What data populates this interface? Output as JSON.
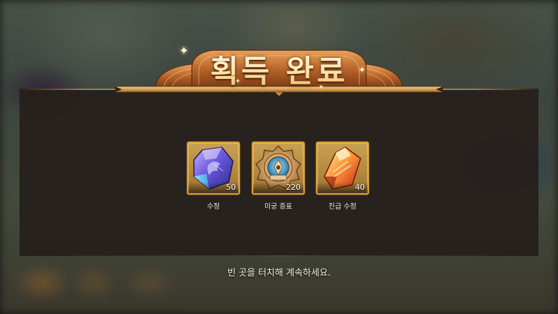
{
  "popup": {
    "title": "획득 완료",
    "continue_hint": "빈 곳을 터치해 계속하세요."
  },
  "rewards": [
    {
      "name": "수정",
      "count": "50",
      "icon": "crystal-icon"
    },
    {
      "name": "미궁 증표",
      "count": "220",
      "icon": "labyrinth-token-icon"
    },
    {
      "name": "진급 수정",
      "count": "40",
      "icon": "promotion-crystal-icon"
    }
  ],
  "colors": {
    "frame_gold": "#d6a23e",
    "panel_dark": "#261f1b",
    "title_fill": "#fff3d8",
    "banner_copper": "#b8652a"
  }
}
